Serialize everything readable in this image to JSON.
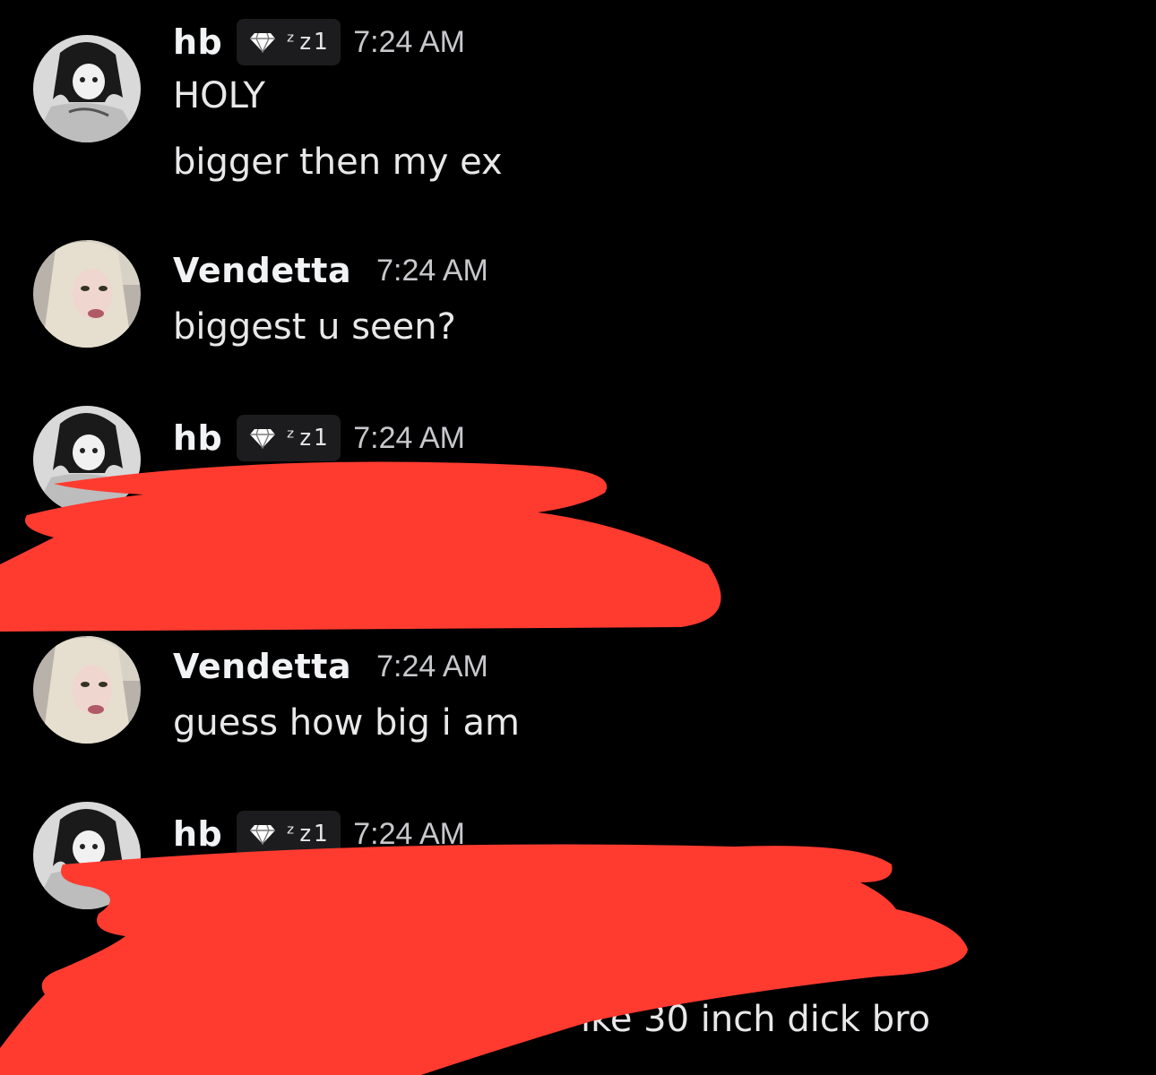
{
  "colors": {
    "background": "#000000",
    "text": "#e8e8ea",
    "username": "#f2f3f5",
    "timestamp": "#c7c8cc",
    "tag_bg": "#1c1c1f",
    "redaction": "#ff3b30"
  },
  "messages": [
    {
      "author": "hb",
      "tag": "ᶻz1",
      "tag_icon": "diamond-icon",
      "time": "7:24 AM",
      "lines": [
        "HOLY",
        "bigger then my ex"
      ]
    },
    {
      "author": "Vendetta",
      "time": "7:24 AM",
      "lines": [
        "biggest u seen?"
      ]
    },
    {
      "author": "hb",
      "tag": "ᶻz1",
      "tag_icon": "diamond-icon",
      "time": "7:24 AM",
      "lines": []
    },
    {
      "author": "Vendetta",
      "time": "7:24 AM",
      "lines": [
        "guess how big i am"
      ]
    },
    {
      "author": "hb",
      "tag": "ᶻz1",
      "tag_icon": "diamond-icon",
      "time": "7:24 AM",
      "lines": [
        "ike 30 inch dick bro"
      ]
    }
  ]
}
